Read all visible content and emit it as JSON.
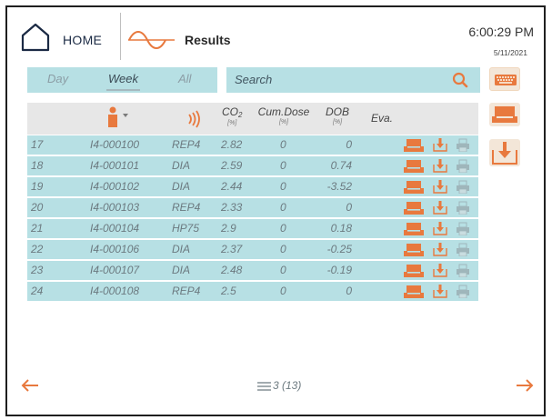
{
  "header": {
    "home_label": "HOME",
    "results_label": "Results",
    "time": "6:00:29 PM",
    "date": "5/11/2021"
  },
  "filters": {
    "tabs": [
      {
        "label": "Day",
        "active": false
      },
      {
        "label": "Week",
        "active": true
      },
      {
        "label": "All",
        "active": false
      }
    ],
    "search_placeholder": "Search"
  },
  "table": {
    "columns": {
      "co2_label": "CO",
      "co2_sub": "2",
      "co2_unit": "[%]",
      "cum_label": "Cum.Dose",
      "cum_unit": "[%]",
      "dob_label": "DOB",
      "dob_unit": "[%]",
      "eva_label": "Eva."
    },
    "rows": [
      {
        "num": "17",
        "id": "I4-000100",
        "type": "REP4",
        "co2": "2.82",
        "cum": "0",
        "dob": "0",
        "eva": false
      },
      {
        "num": "18",
        "id": "I4-000101",
        "type": "DIA",
        "co2": "2.59",
        "cum": "0",
        "dob": "0.74",
        "eva": true
      },
      {
        "num": "19",
        "id": "I4-000102",
        "type": "DIA",
        "co2": "2.44",
        "cum": "0",
        "dob": "-3.52",
        "eva": true
      },
      {
        "num": "20",
        "id": "I4-000103",
        "type": "REP4",
        "co2": "2.33",
        "cum": "0",
        "dob": "0",
        "eva": false
      },
      {
        "num": "21",
        "id": "I4-000104",
        "type": "HP75",
        "co2": "2.9",
        "cum": "0",
        "dob": "0.18",
        "eva": true
      },
      {
        "num": "22",
        "id": "I4-000106",
        "type": "DIA",
        "co2": "2.37",
        "cum": "0",
        "dob": "-0.25",
        "eva": true
      },
      {
        "num": "23",
        "id": "I4-000107",
        "type": "DIA",
        "co2": "2.48",
        "cum": "0",
        "dob": "-0.19",
        "eva": true
      },
      {
        "num": "24",
        "id": "I4-000108",
        "type": "REP4",
        "co2": "2.5",
        "cum": "0",
        "dob": "0",
        "eva": false
      }
    ]
  },
  "footer": {
    "pager": "3 (13)"
  },
  "colors": {
    "accent": "#e8793e",
    "row_bg": "#b7e0e4",
    "header_bg": "#e7e7e7",
    "navy": "#1b2a44"
  },
  "icons": {
    "home": "home-icon",
    "waveform": "waveform-icon",
    "person_filter": "person-icon",
    "signal": "signal-waves-icon",
    "search": "search-icon",
    "keyboard": "keyboard-icon",
    "tray": "tray-icon",
    "export": "export-icon",
    "download": "download-icon",
    "print": "print-icon",
    "prev": "arrow-left-icon",
    "next": "arrow-right-icon",
    "menu": "list-icon"
  }
}
